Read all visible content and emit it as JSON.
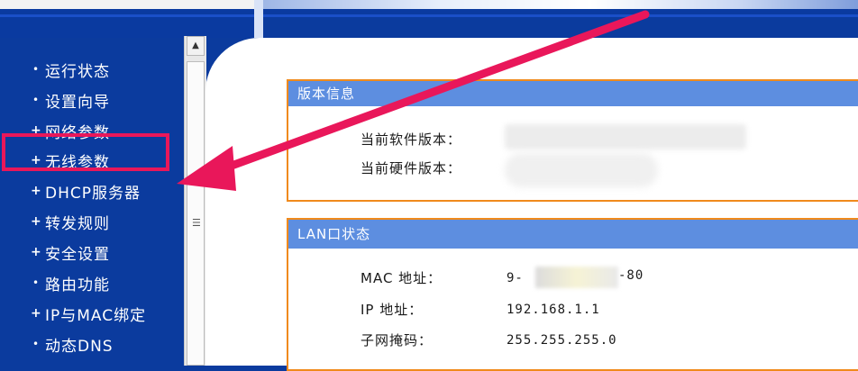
{
  "sidebar": {
    "items": [
      {
        "label": "运行状态",
        "marker": "•"
      },
      {
        "label": "设置向导",
        "marker": "•"
      },
      {
        "label": "网络参数",
        "marker": "+"
      },
      {
        "label": "无线参数",
        "marker": "+"
      },
      {
        "label": "DHCP服务器",
        "marker": "+"
      },
      {
        "label": "转发规则",
        "marker": "+"
      },
      {
        "label": "安全设置",
        "marker": "+"
      },
      {
        "label": "路由功能",
        "marker": "•"
      },
      {
        "label": "IP与MAC绑定",
        "marker": "+"
      },
      {
        "label": "动态DNS",
        "marker": "•"
      }
    ]
  },
  "version_panel": {
    "title": "版本信息",
    "software_label": "当前软件版本：",
    "hardware_label": "当前硬件版本："
  },
  "lan_panel": {
    "title": "LAN口状态",
    "mac_label": "MAC 地址：",
    "mac_value_start": "9-",
    "mac_value_end": "-80",
    "ip_label": "IP 地址：",
    "ip_value": "192.168.1.1",
    "mask_label": "子网掩码：",
    "mask_value": "255.255.255.0"
  },
  "colors": {
    "sidebar_bg": "#0b3b9e",
    "panel_header": "#5d8ee0",
    "panel_border": "#f08a1c",
    "highlight": "#e9175a"
  }
}
